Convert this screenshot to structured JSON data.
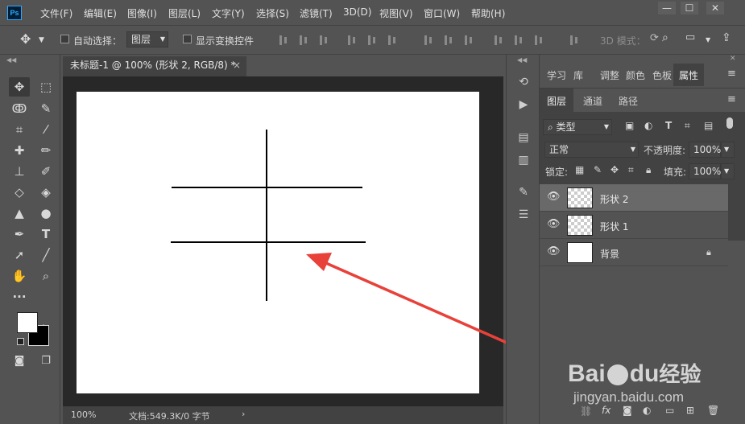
{
  "app": {
    "logo": "Ps",
    "window_buttons": [
      "—",
      "☐",
      "✕"
    ]
  },
  "menu": [
    "文件(F)",
    "编辑(E)",
    "图像(I)",
    "图层(L)",
    "文字(Y)",
    "选择(S)",
    "滤镜(T)",
    "3D(D)",
    "视图(V)",
    "窗口(W)",
    "帮助(H)"
  ],
  "options": {
    "auto_select_label": "自动选择：",
    "auto_select_value": "图层",
    "show_transform_label": "显示变换控件",
    "mode_3d_label": "3D 模式："
  },
  "document": {
    "tab_title": "未标题-1 @ 100% (形状 2, RGB/8) *",
    "close_glyph": "×"
  },
  "status": {
    "zoom": "100%",
    "doc_info": "文档:549.3K/0 字节",
    "arrow": "›"
  },
  "panel_tabs_top": [
    "学习",
    "库",
    "调整",
    "颜色",
    "色板",
    "属性"
  ],
  "panel_tabs_layers": [
    "图层",
    "通道",
    "路径"
  ],
  "layers_panel": {
    "filter_label": "类型",
    "blend_mode": "正常",
    "opacity_label": "不透明度:",
    "opacity_value": "100%",
    "lock_label": "锁定:",
    "fill_label": "填充:",
    "fill_value": "100%",
    "layers": [
      {
        "name": "形状 2",
        "thumb": "transparent",
        "selected": true
      },
      {
        "name": "形状 1",
        "thumb": "transparent",
        "selected": false
      },
      {
        "name": "背景",
        "thumb": "white",
        "selected": false,
        "locked": true
      }
    ]
  },
  "watermark": {
    "line1": "Bai",
    "line1b": "du",
    "line1c": "经验",
    "line2": "jingyan.baidu.com"
  },
  "colors": {
    "accent_arrow": "#e8413a",
    "bg": "#535353",
    "workspace": "#282828",
    "selected_layer": "#696969"
  }
}
